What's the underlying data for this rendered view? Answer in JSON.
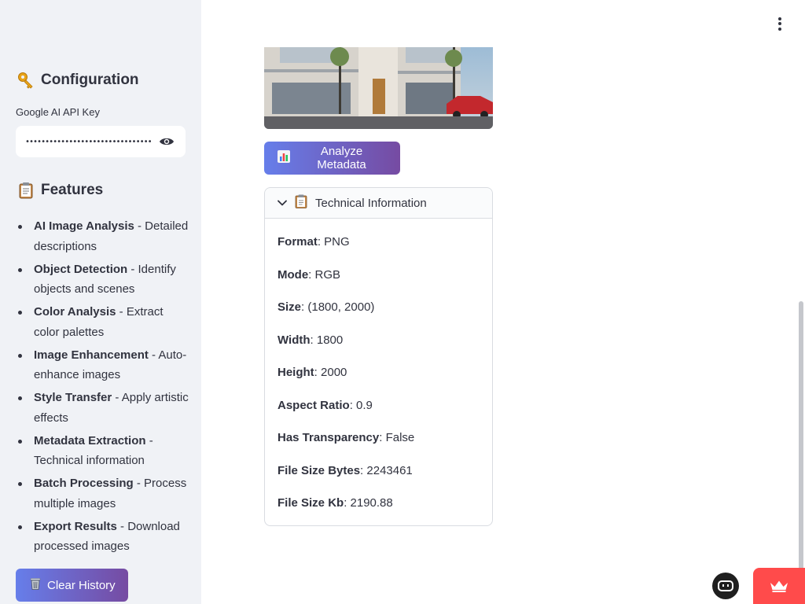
{
  "sidebar": {
    "config_heading": "Configuration",
    "config_icon": "key-icon",
    "api_label": "Google AI API Key",
    "api_value": "••••••••••••••••••••••••••••••••••",
    "features_heading": "Features",
    "features_icon": "clipboard-icon",
    "features": [
      {
        "name": "AI Image Analysis",
        "desc": " - Detailed descriptions"
      },
      {
        "name": "Object Detection",
        "desc": " - Identify objects and scenes"
      },
      {
        "name": "Color Analysis",
        "desc": " - Extract color palettes"
      },
      {
        "name": "Image Enhancement",
        "desc": " - Auto-enhance images"
      },
      {
        "name": "Style Transfer",
        "desc": " - Apply artistic effects"
      },
      {
        "name": "Metadata Extraction",
        "desc": " - Technical information"
      },
      {
        "name": "Batch Processing",
        "desc": " - Process multiple images"
      },
      {
        "name": "Export Results",
        "desc": " - Download processed images"
      }
    ],
    "clear_label": "Clear History",
    "clear_icon": "trash-icon"
  },
  "main": {
    "analyze_label": "Analyze Metadata",
    "analyze_icon": "bar-chart-icon",
    "expander_title": "Technical Information",
    "expander_icon": "clipboard-icon",
    "info": [
      {
        "key": "Format",
        "value": ": PNG"
      },
      {
        "key": "Mode",
        "value": ": RGB"
      },
      {
        "key": "Size",
        "value": ": (1800, 2000)"
      },
      {
        "key": "Width",
        "value": ": 1800"
      },
      {
        "key": "Height",
        "value": ": 2000"
      },
      {
        "key": "Aspect Ratio",
        "value": ": 0.9"
      },
      {
        "key": "Has Transparency",
        "value": ": False"
      },
      {
        "key": "File Size Bytes",
        "value": ": 2243461"
      },
      {
        "key": "File Size Kb",
        "value": ": 2190.88"
      }
    ]
  },
  "colors": {
    "sidebar_bg": "#f0f2f6",
    "gradient_start": "#667eea",
    "gradient_end": "#764ba2",
    "accent_red": "#ff4b4b"
  }
}
